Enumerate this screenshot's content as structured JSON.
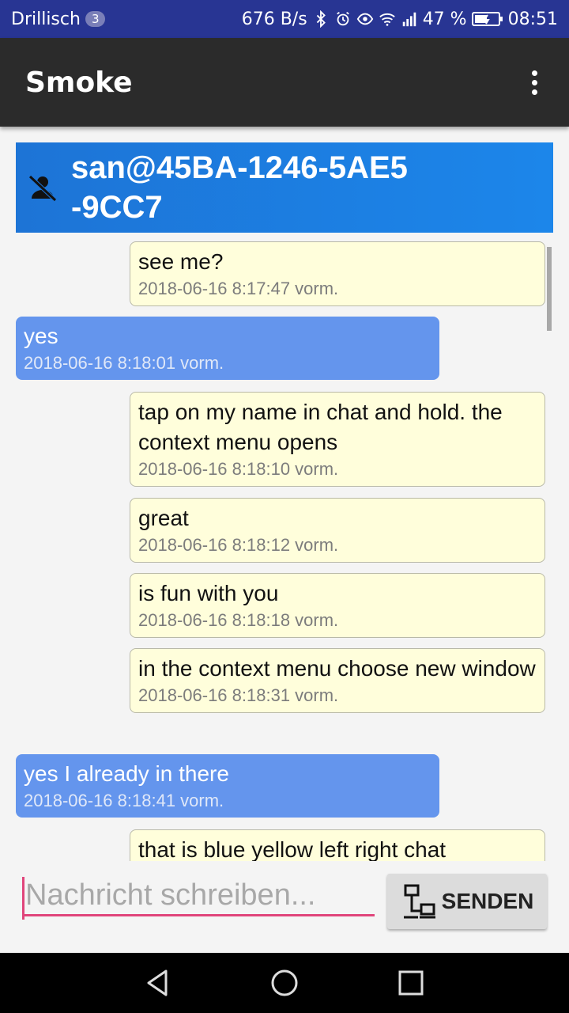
{
  "status_bar": {
    "carrier": "Drillisch",
    "carrier_badge": "3",
    "net_speed": "676 B/s",
    "battery": "47 %",
    "time": "08:51"
  },
  "app_bar": {
    "title": "Smoke"
  },
  "contact": {
    "name": "san@45BA-1246-5AE5 -9CC7"
  },
  "messages": [
    {
      "side": "out",
      "text": "see me?",
      "time": "2018-06-16 8:17:47 vorm."
    },
    {
      "side": "in",
      "text": "yes",
      "time": "2018-06-16 8:18:01 vorm."
    },
    {
      "side": "out",
      "text": "tap on my name in chat and hold. the context menu opens",
      "time": "2018-06-16 8:18:10 vorm."
    },
    {
      "side": "out",
      "text": "great",
      "time": "2018-06-16 8:18:12 vorm."
    },
    {
      "side": "out",
      "text": "is fun with you",
      "time": "2018-06-16 8:18:18 vorm."
    },
    {
      "side": "out",
      "text": "in the context menu choose new window",
      "time": "2018-06-16 8:18:31 vorm."
    },
    {
      "side": "in",
      "text": "yes I already in there",
      "time": "2018-06-16 8:18:41 vorm."
    },
    {
      "side": "out",
      "text": "that is blue yellow left right chat",
      "time": ""
    }
  ],
  "composer": {
    "placeholder": "Nachricht schreiben...",
    "send_label": "SENDEN"
  },
  "colors": {
    "status_bar": "#283593",
    "app_bar": "#2b2b2b",
    "contact_banner": "#1d74d6",
    "outgoing_bubble": "#fffedb",
    "incoming_bubble": "#6495ed",
    "input_accent": "#e0457b"
  },
  "icons": {
    "contact": "person-off-icon",
    "send": "network-icon",
    "overflow": "more-vert-icon"
  }
}
